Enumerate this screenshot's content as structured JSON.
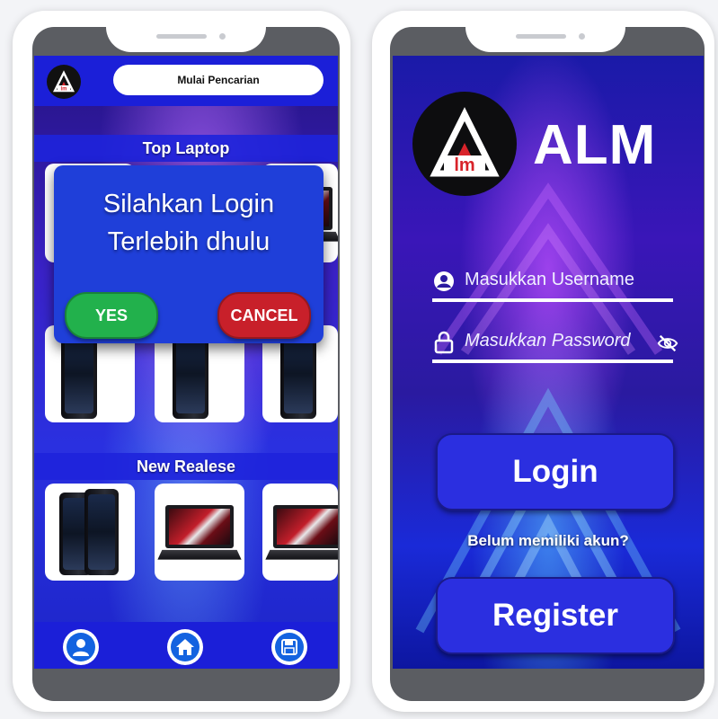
{
  "left_screen": {
    "search": {
      "label": "Mulai Pencarian"
    },
    "sections": {
      "top_laptop": "Top Laptop",
      "new_release": "New Realese"
    },
    "dialog": {
      "message_line1": "Silahkan Login",
      "message_line2": "Terlebih dhulu",
      "yes_label": "YES",
      "cancel_label": "CANCEL"
    },
    "bottom_nav": [
      {
        "icon": "user-icon"
      },
      {
        "icon": "home-icon"
      },
      {
        "icon": "save-icon"
      }
    ]
  },
  "right_screen": {
    "brand": "ALM",
    "username": {
      "placeholder": "Masukkan Username",
      "icon": "user-icon"
    },
    "password": {
      "placeholder": "Masukkan Password",
      "icon": "lock-icon",
      "toggle_icon": "eye-off-icon"
    },
    "login_label": "Login",
    "signup_question": "Belum memiliki akun?",
    "register_label": "Register"
  },
  "colors": {
    "primary_blue": "#1b1fd8",
    "yes_green": "#22b14c",
    "cancel_red": "#c8202a",
    "button_blue": "#2b2fe0"
  }
}
